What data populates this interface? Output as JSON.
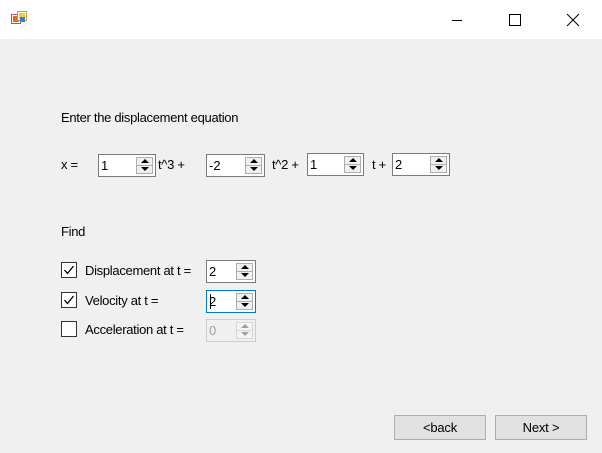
{
  "window": {
    "icon": "app-icon",
    "minimize_icon": "minimize-icon",
    "maximize_icon": "maximize-icon",
    "close_icon": "close-icon"
  },
  "equation": {
    "heading": "Enter the displacement equation",
    "x_label": "x =",
    "coef_a": "1",
    "t3_label": "t^3 +",
    "coef_b": "-2",
    "t2_label": "t^2 +",
    "coef_c": "1",
    "t_label": "t +",
    "coef_d": "2"
  },
  "find": {
    "heading": "Find",
    "displacement": {
      "label": "Displacement at t =",
      "checked": true,
      "value": "2",
      "enabled": true
    },
    "velocity": {
      "label": "Velocity at t =",
      "checked": true,
      "value": "2",
      "enabled": true
    },
    "acceleration": {
      "label": "Acceleration at t =",
      "checked": false,
      "value": "0",
      "enabled": false
    }
  },
  "buttons": {
    "back": "<back",
    "next": "Next >"
  }
}
